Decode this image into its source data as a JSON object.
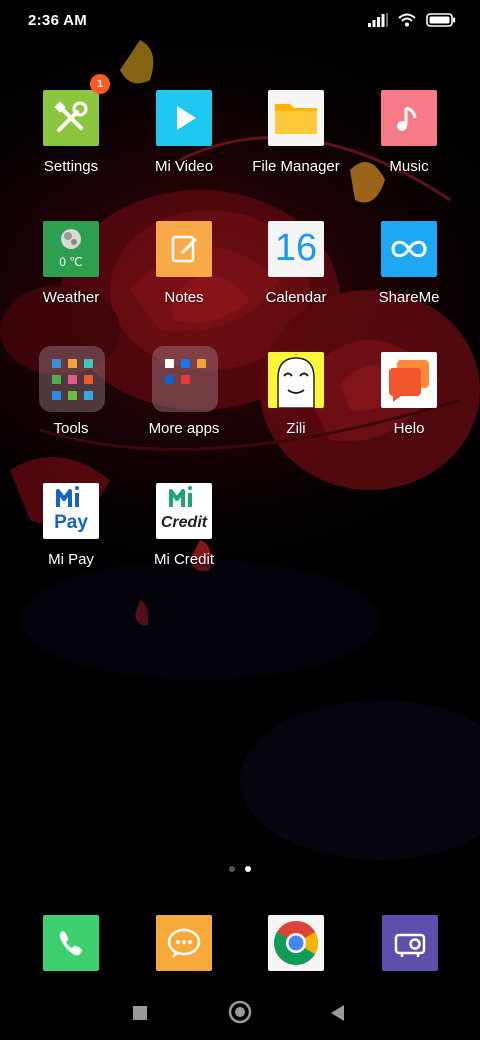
{
  "status_bar": {
    "time": "2:36 AM"
  },
  "apps": [
    {
      "id": "settings",
      "label": "Settings",
      "badge": "1"
    },
    {
      "id": "mi-video",
      "label": "Mi Video"
    },
    {
      "id": "file-manager",
      "label": "File Manager"
    },
    {
      "id": "music",
      "label": "Music"
    },
    {
      "id": "weather",
      "label": "Weather",
      "temp": "0 ℃"
    },
    {
      "id": "notes",
      "label": "Notes"
    },
    {
      "id": "calendar",
      "label": "Calendar",
      "day": "16"
    },
    {
      "id": "shareme",
      "label": "ShareMe"
    },
    {
      "id": "tools",
      "label": "Tools"
    },
    {
      "id": "more-apps",
      "label": "More apps"
    },
    {
      "id": "zili",
      "label": "Zili"
    },
    {
      "id": "helo",
      "label": "Helo"
    },
    {
      "id": "mi-pay",
      "label": "Mi Pay",
      "logo_text": "Pay"
    },
    {
      "id": "mi-credit",
      "label": "Mi Credit",
      "logo_text": "Credit"
    }
  ],
  "page_indicator": {
    "pages": 2,
    "current": 2
  },
  "dock": [
    {
      "id": "phone",
      "icon": "phone-icon"
    },
    {
      "id": "messaging",
      "icon": "message-icon"
    },
    {
      "id": "chrome",
      "icon": "chrome-icon"
    },
    {
      "id": "screen-recorder",
      "icon": "projector-icon"
    }
  ],
  "nav": {
    "recents": "square-icon",
    "home": "circle-icon",
    "back": "triangle-icon"
  },
  "colors": {
    "settings": "#8cc63f",
    "mi_video": "#1ec8f0",
    "file_manager": "#ffb300",
    "music": "#f77b86",
    "weather": "#2e9e4f",
    "notes": "#f8a94a",
    "shareme": "#1ea7f3",
    "helo": "#f2552c",
    "phone": "#3ecf6e",
    "messaging": "#f7a93a",
    "recorder": "#5e4fae",
    "badge": "#ff5a1f"
  }
}
